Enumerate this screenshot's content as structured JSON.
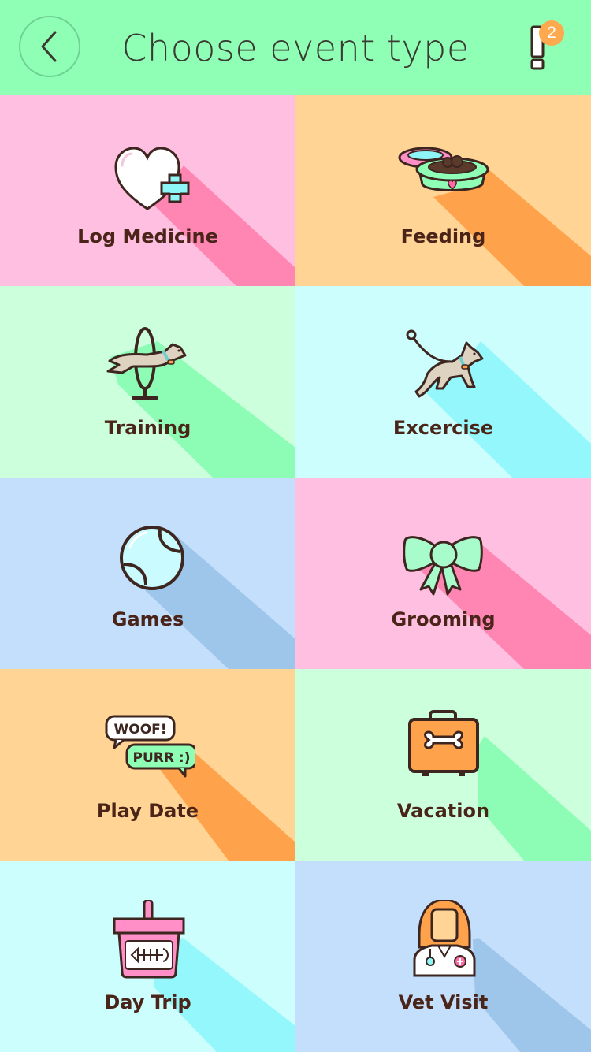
{
  "header": {
    "title": "Choose event type",
    "back_icon": "chevron-left-icon",
    "notification_icon": "exclamation-icon",
    "notification_count": "2"
  },
  "colors": {
    "header_bg": "#8effb5",
    "badge": "#ffa94e",
    "label_text": "#4a2418"
  },
  "tiles": [
    {
      "label": "Log Medicine",
      "icon": "heart-plus-icon",
      "bg": "#ffbfe0",
      "shadow": "#ff86b3"
    },
    {
      "label": "Feeding",
      "icon": "food-bowls-icon",
      "bg": "#ffd494",
      "shadow": "#ffa24c"
    },
    {
      "label": "Training",
      "icon": "dog-hoop-jump-icon",
      "bg": "#ccffdc",
      "shadow": "#8dfcb4"
    },
    {
      "label": "Excercise",
      "icon": "dog-on-leash-icon",
      "bg": "#ccfefe",
      "shadow": "#94f7fb"
    },
    {
      "label": "Games",
      "icon": "tennis-ball-icon",
      "bg": "#c4dffc",
      "shadow": "#9ec5ea"
    },
    {
      "label": "Grooming",
      "icon": "bow-ribbon-icon",
      "bg": "#ffbfe0",
      "shadow": "#ff86b3"
    },
    {
      "label": "Play Date",
      "icon": "speech-bubbles-icon",
      "bg": "#ffd494",
      "shadow": "#ffa24c",
      "bubble1": "WOOF!",
      "bubble2": "PURR :)"
    },
    {
      "label": "Vacation",
      "icon": "suitcase-bone-icon",
      "bg": "#ccffdc",
      "shadow": "#8dfcb4"
    },
    {
      "label": "Day Trip",
      "icon": "fish-basket-icon",
      "bg": "#ccfefe",
      "shadow": "#94f7fb"
    },
    {
      "label": "Vet Visit",
      "icon": "vet-doctor-icon",
      "bg": "#c4dffc",
      "shadow": "#9ec5ea"
    }
  ]
}
